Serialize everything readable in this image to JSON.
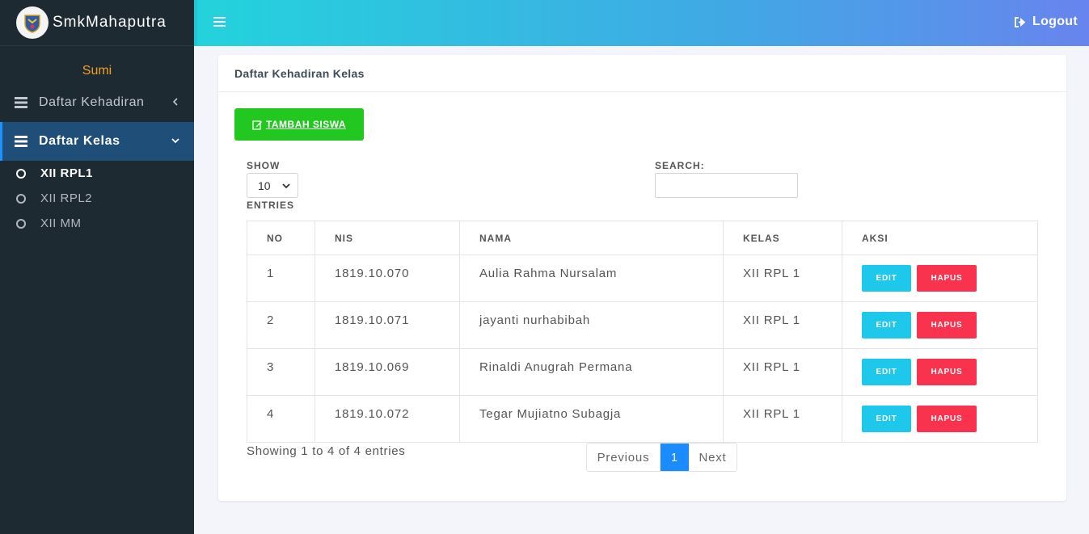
{
  "brand": {
    "name": "SmkMahaputra",
    "logo_icon": "school-emblem-icon"
  },
  "sidebar": {
    "user": "Sumi",
    "items": [
      {
        "label": "Daftar Kehadiran",
        "icon": "list-icon",
        "expanded": false
      },
      {
        "label": "Daftar Kelas",
        "icon": "list-icon",
        "expanded": true
      }
    ],
    "sub_items": [
      {
        "label": "XII RPL1",
        "active": true
      },
      {
        "label": "XII RPL2",
        "active": false
      },
      {
        "label": "XII MM",
        "active": false
      }
    ]
  },
  "header": {
    "menu_icon": "hamburger-icon",
    "logout_label": "Logout"
  },
  "card": {
    "title": "Daftar Kehadiran Kelas",
    "add_button": "TAMBAH SISWA",
    "show_label": "SHOW",
    "entries_label": "ENTRIES",
    "page_size": "10",
    "search_label": "SEARCH:",
    "search_value": ""
  },
  "table": {
    "headers": [
      "NO",
      "NIS",
      "NAMA",
      "KELAS",
      "AKSI"
    ],
    "rows": [
      {
        "no": "1",
        "nis": "1819.10.070",
        "nama": "Aulia Rahma Nursalam",
        "kelas": "XII RPL 1"
      },
      {
        "no": "2",
        "nis": "1819.10.071",
        "nama": "jayanti nurhabibah",
        "kelas": "XII RPL 1"
      },
      {
        "no": "3",
        "nis": "1819.10.069",
        "nama": "Rinaldi Anugrah Permana",
        "kelas": "XII RPL 1"
      },
      {
        "no": "4",
        "nis": "1819.10.072",
        "nama": "Tegar Mujiatno Subagja",
        "kelas": "XII RPL 1"
      }
    ],
    "edit_label": "EDIT",
    "delete_label": "HAPUS"
  },
  "footer": {
    "showing": "Showing 1 to 4 of 4 entries",
    "prev": "Previous",
    "page": "1",
    "next": "Next"
  },
  "colors": {
    "sidebar_bg": "#1e2a32",
    "active_nav": "#1f4e79",
    "user_name": "#f0a020",
    "add_button": "#22c81f",
    "edit_button": "#1ec8ea",
    "delete_button": "#f9334e",
    "page_active": "#1a8cff"
  }
}
